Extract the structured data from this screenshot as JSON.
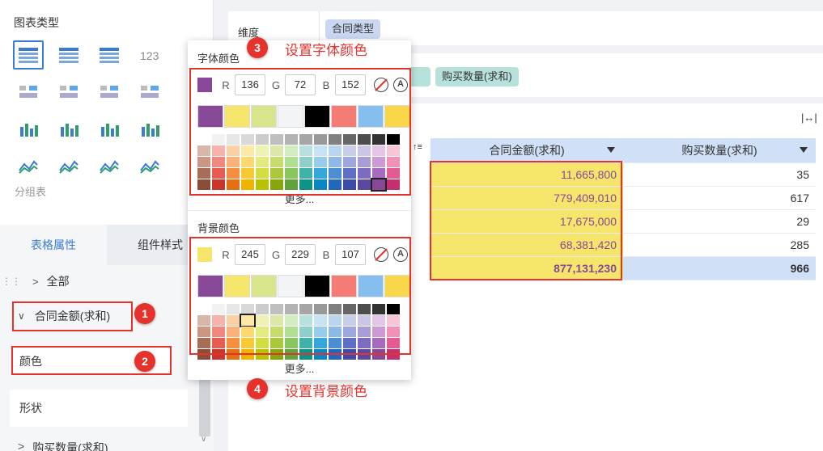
{
  "left_panel": {
    "chart_type_title": "图表类型",
    "chart_icons": [
      "table-icon",
      "cross-table-icon",
      "detail-table-icon",
      "number-123-icon",
      "kpi-icon",
      "dot-list-icon",
      "map-icon",
      "bar-vertical-icon",
      "column-chart-icon",
      "grouped-column-icon",
      "stacked-bar-icon",
      "step-bar-icon",
      "area-chart-icon",
      "line-chart-icon",
      "radar-chart-icon",
      "trend-chart-icon"
    ],
    "chart_group_label": "分组表",
    "tabs": {
      "table_props": "表格属性",
      "component_style": "组件样式"
    },
    "props": {
      "all": "全部",
      "contract_amount": "合同金额(求和)",
      "color": "颜色",
      "shape": "形状",
      "purchase_qty": "购买数量(求和)"
    }
  },
  "right_panel": {
    "dimension_label": "维度",
    "dimension_pill": "合同类型",
    "indicator_pill": "购买数量(求和)",
    "table": {
      "headers": [
        "合同金额(求和)",
        "购买数量(求和)"
      ],
      "rows": [
        [
          "11,665,800",
          "35"
        ],
        [
          "779,409,010",
          "617"
        ],
        [
          "17,675,000",
          "29"
        ],
        [
          "68,381,420",
          "285"
        ]
      ],
      "total": [
        "877,131,230",
        "966"
      ]
    }
  },
  "popup": {
    "font_title": "字体颜色",
    "font_rgb": {
      "r": "136",
      "g": "72",
      "b": "152"
    },
    "bg_title": "背景颜色",
    "bg_rgb": {
      "r": "245",
      "g": "229",
      "b": "107"
    },
    "rgb_labels": {
      "r": "R",
      "g": "G",
      "b": "B"
    },
    "more": "更多...",
    "big_swatches": [
      "#884898",
      "#f5e56b",
      "#d8e58c",
      "#f3f4f5",
      "#000000",
      "#f47c74",
      "#86bfef",
      "#f8d74a"
    ],
    "palette": [
      [
        "#ffffff",
        "#f2f2f2",
        "#e6e6e6",
        "#d9d9d9",
        "#cccccc",
        "#bfbfbf",
        "#b3b3b3",
        "#a6a6a6",
        "#999999",
        "#808080",
        "#666666",
        "#4d4d4d",
        "#333333",
        "#000000"
      ],
      [
        "#d9b7a8",
        "#f6b3ad",
        "#fbd0a4",
        "#fde9a6",
        "#eef2b3",
        "#dbe8a7",
        "#d4edc0",
        "#b6e1de",
        "#c5e3f3",
        "#b9d5f0",
        "#c8cdea",
        "#ccc6e6",
        "#e2c5e8",
        "#f7c4d8"
      ],
      [
        "#c99784",
        "#f18880",
        "#f9b37a",
        "#fcd871",
        "#e3ea81",
        "#c7dc6e",
        "#b2de93",
        "#8fcfca",
        "#96cdeb",
        "#8eb9e6",
        "#9ea7dc",
        "#a99dd6",
        "#cc9bd6",
        "#f092b8"
      ],
      [
        "#a86e55",
        "#e75b51",
        "#f58f3d",
        "#f9c934",
        "#d2dd3f",
        "#aac93a",
        "#8ac65e",
        "#3fb3a8",
        "#33a8dc",
        "#4b8ed6",
        "#5f6ec5",
        "#7c6bc0",
        "#a66bbf",
        "#e45a93"
      ],
      [
        "#8a4e38",
        "#c8352c",
        "#e46e13",
        "#f0b400",
        "#b8c200",
        "#87a60c",
        "#60a33a",
        "#0e9186",
        "#0a86c3",
        "#2168bd",
        "#3c4aa8",
        "#5b48a0",
        "#884898",
        "#c2306f"
      ]
    ],
    "font_selected": "#884898",
    "bg_selected": "#f5e56b"
  },
  "annotations": {
    "step3": "设置字体颜色",
    "step4": "设置背景颜色",
    "badges": [
      "1",
      "2",
      "3",
      "4"
    ]
  },
  "colors": {
    "accent": "#3a7bd5",
    "annotation_red": "#e5322d",
    "header_blue": "#cfe0f7",
    "highlight_yellow": "#f5e56b",
    "font_purple": "#884898",
    "pill_blue": "#c9d7f0",
    "pill_teal": "#b7e2dc"
  }
}
